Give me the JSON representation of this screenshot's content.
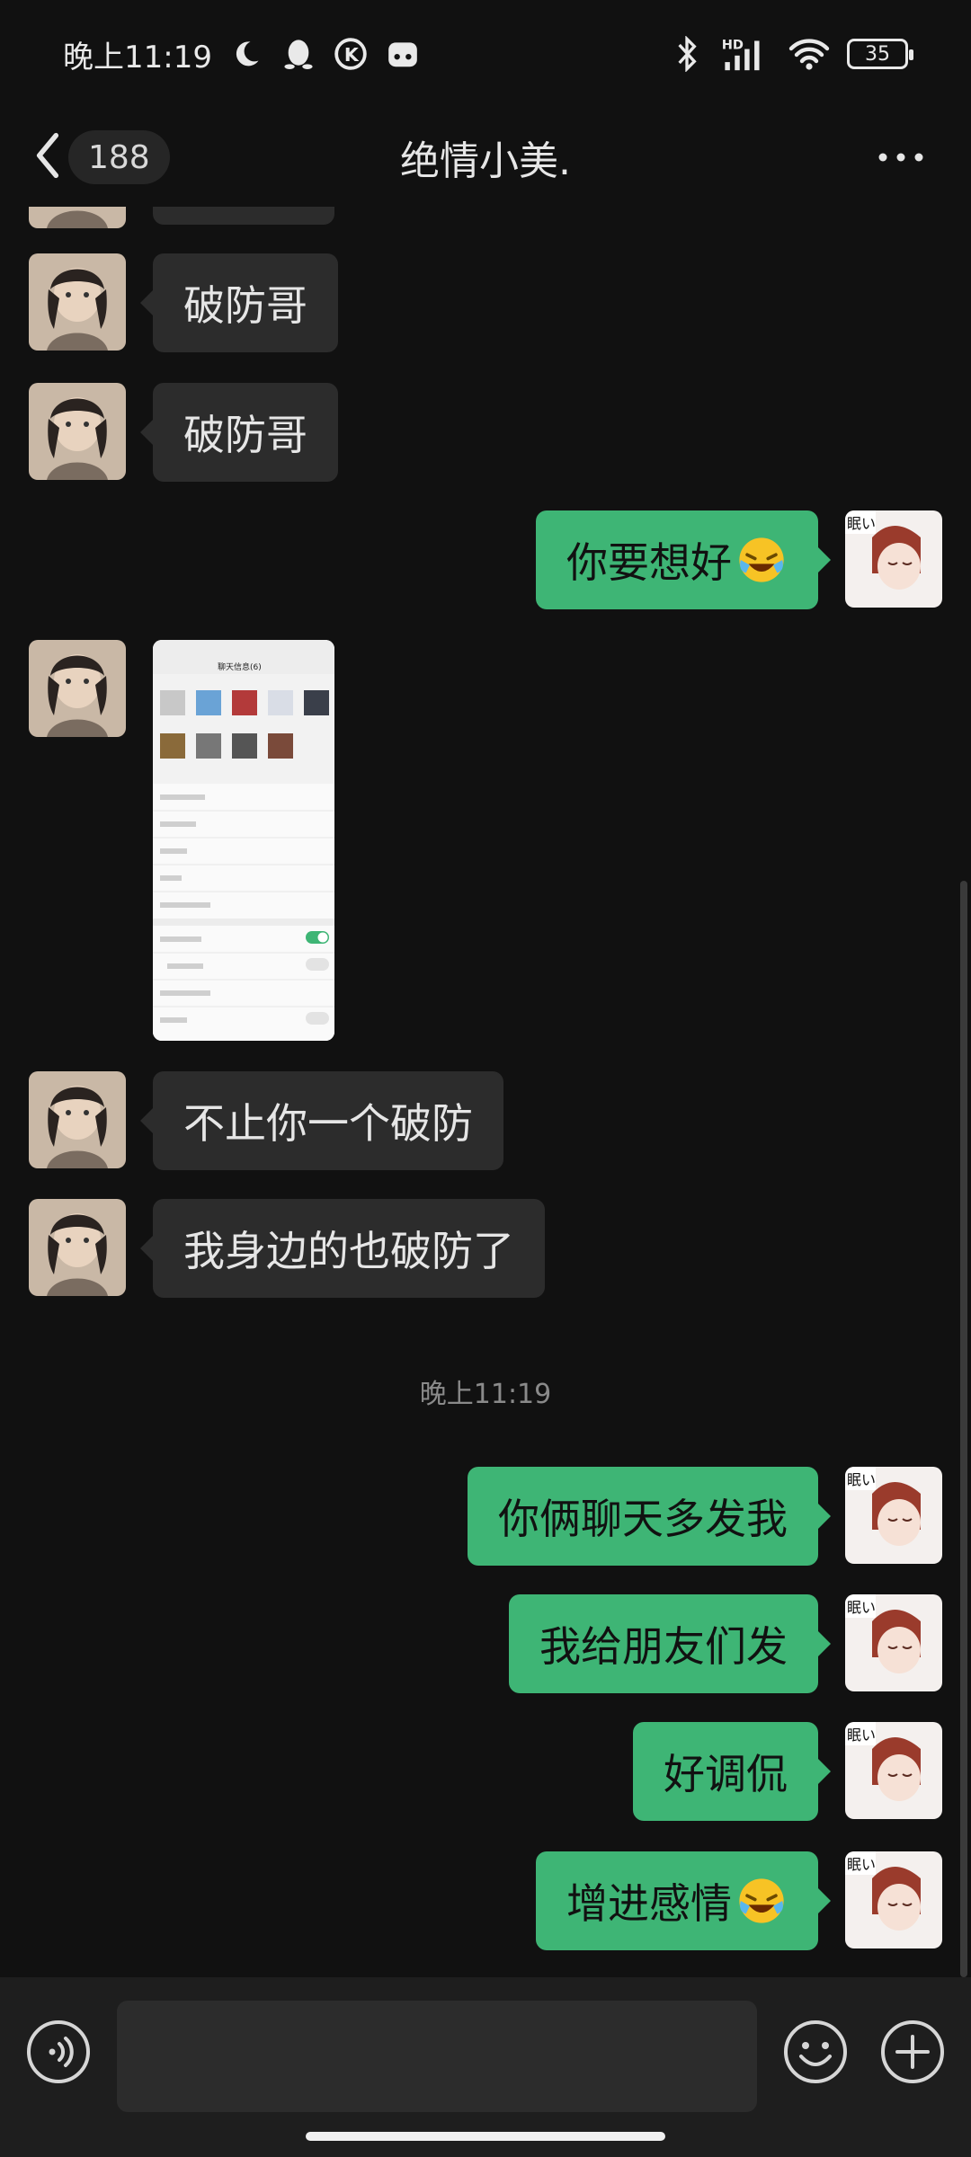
{
  "status_bar": {
    "time": "晚上11:19",
    "network": "HD",
    "battery": "35"
  },
  "header": {
    "unread_count": "188",
    "title": "绝情小美."
  },
  "messages": [
    {
      "side": "in",
      "text": "破防哥"
    },
    {
      "side": "in",
      "text": "破防哥"
    },
    {
      "side": "out",
      "text": "你要想好",
      "emoji": "laughing-crying-emoji"
    },
    {
      "side": "in",
      "type": "image",
      "text": "聊天信息(6)"
    },
    {
      "side": "in",
      "text": "不止你一个破防"
    },
    {
      "side": "in",
      "text": "我身边的也破防了"
    },
    {
      "side": "out",
      "text": "你俩聊天多发我"
    },
    {
      "side": "out",
      "text": "我给朋友们发"
    },
    {
      "side": "out",
      "text": "好调侃"
    },
    {
      "side": "out",
      "text": "增进感情",
      "emoji": "laughing-crying-emoji"
    }
  ],
  "timestamp": "晚上11:19",
  "sticker_label": "眠い",
  "colors": {
    "background": "#111111",
    "bubble_in": "#2c2c2c",
    "bubble_out": "#3eb575",
    "input_bar": "#1e1e1e"
  }
}
